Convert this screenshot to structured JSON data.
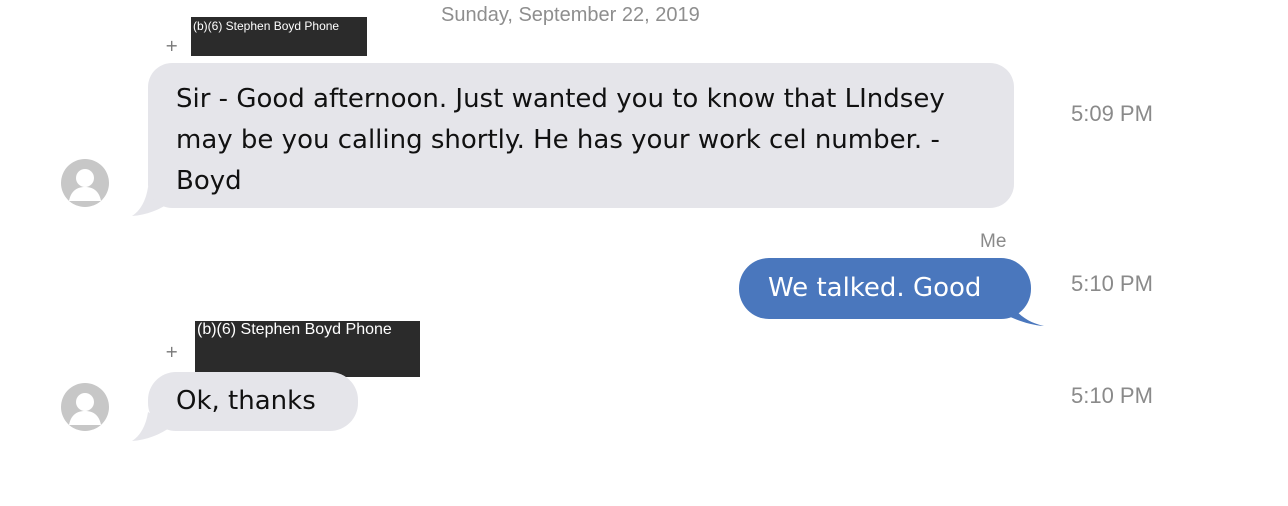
{
  "conversation": {
    "date_header": "Sunday, September 22, 2019",
    "messages": [
      {
        "direction": "incoming",
        "plus": "+",
        "sender_label": "(b)(6) Stephen Boyd Phone",
        "text": "Sir - Good afternoon. Just wanted you to know that LIndsey may be you calling shortly. He has your work cel number. - Boyd",
        "time": "5:09 PM",
        "avatar_icon": "default-contact-avatar-icon"
      },
      {
        "direction": "outgoing",
        "sender_label": "Me",
        "text": "We talked. Good",
        "time": "5:10 PM"
      },
      {
        "direction": "incoming",
        "plus": "+",
        "sender_label": "(b)(6) Stephen Boyd Phone",
        "text": "Ok, thanks",
        "time": "5:10 PM",
        "avatar_icon": "default-contact-avatar-icon"
      }
    ]
  },
  "colors": {
    "incoming_bubble": "#e5e5ea",
    "outgoing_bubble": "#4a77bd",
    "redaction_box": "#2b2b2b",
    "timestamp_text": "#8a8a8a"
  }
}
